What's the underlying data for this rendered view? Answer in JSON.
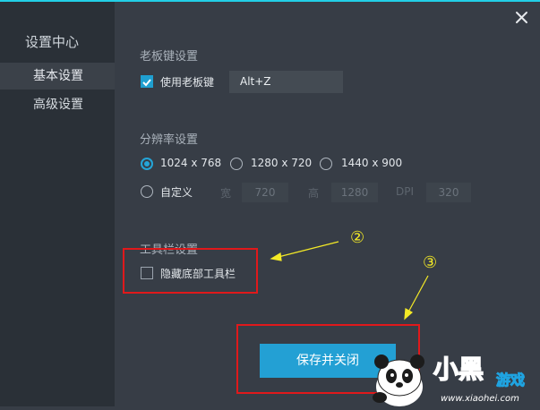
{
  "sidebar": {
    "title": "设置中心",
    "items": [
      {
        "label": "基本设置",
        "active": true
      },
      {
        "label": "高级设置",
        "active": false
      }
    ]
  },
  "close_icon": "close-icon",
  "boss_key": {
    "section_title": "老板键设置",
    "checkbox_label": "使用老板键",
    "checked": true,
    "hotkey_value": "Alt+Z"
  },
  "resolution": {
    "section_title": "分辨率设置",
    "options": [
      "1024 x 768",
      "1280 x 720",
      "1440 x 900"
    ],
    "selected": "1024 x 768",
    "custom_label": "自定义",
    "width_caption": "宽",
    "width_value": "720",
    "height_caption": "高",
    "height_value": "1280",
    "dpi_caption": "DPI",
    "dpi_value": "320"
  },
  "toolbar": {
    "section_title": "工具栏设置",
    "checkbox_label": "隐藏底部工具栏",
    "checked": false
  },
  "actions": {
    "save_label": "保存并关闭"
  },
  "annotations": {
    "marker_2": "②",
    "marker_3": "③"
  },
  "watermark": {
    "text": "小黑游戏",
    "url": "www.xiaohei.com"
  },
  "colors": {
    "accent": "#23a0d4",
    "highlight_box": "#e0191b",
    "annotation": "#f4ea26",
    "sidebar_bg": "#2a3037",
    "panel_bg": "#373d46"
  }
}
